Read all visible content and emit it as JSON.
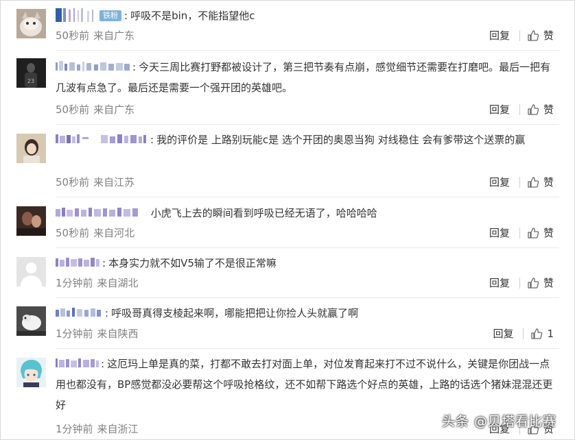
{
  "comments": [
    {
      "badge": "铁粉",
      "text": "呼吸不是bin，不能指望他c",
      "time": "50秒前",
      "loc": "来自广东",
      "reply": "回复",
      "like": "赞"
    },
    {
      "badge": "",
      "text": "今天三周比赛打野都被设计了，第三把节奏有点崩，感觉细节还需要在打磨吧。最后一把有几波有点急了。最后还是需要一个强开团的英雄吧。",
      "time": "50秒前",
      "loc": "来自广东",
      "reply": "回复",
      "like": "赞"
    },
    {
      "badge": "",
      "text": "我的评价是 上路别玩能c是 选个开团的奥恩当狗 对线稳住 会有爹带这个送票的赢",
      "time": "50秒前",
      "loc": "来自江苏",
      "reply": "回复",
      "like": "赞"
    },
    {
      "badge": "",
      "text": "小虎飞上去的瞬间看到呼吸已经无语了，哈哈哈哈",
      "time": "50秒前",
      "loc": "来自河北",
      "reply": "回复",
      "like": "赞"
    },
    {
      "badge": "",
      "text": "本身实力就不如V5输了不是很正常嘛",
      "time": "1分钟前",
      "loc": "来自湖北",
      "reply": "回复",
      "like": "赞"
    },
    {
      "badge": "",
      "text": "呼吸哥真得支棱起来啊，哪能把把让你捡人头就赢了啊",
      "time": "1分钟前",
      "loc": "来自陕西",
      "reply": "回复",
      "like": "1"
    },
    {
      "badge": "",
      "text": "这厄玛上单是真的菜，打都不敢去打对面上单，对位发育起来打不过不说什么，关键是你团战一点用也都没有，BP感觉都没必要帮这个呼吸抢格纹，还不如帮下路选个好点的英雄，上路的话选个猪妹混混还更好",
      "time": "1分钟前",
      "loc": "来自浙江",
      "reply": "回复",
      "like": "赞"
    }
  ],
  "watermark": "头条 @贝塔看比赛",
  "colors": {
    "text": "#333333",
    "meta": "#808080",
    "badge": "#7fb2d9"
  }
}
